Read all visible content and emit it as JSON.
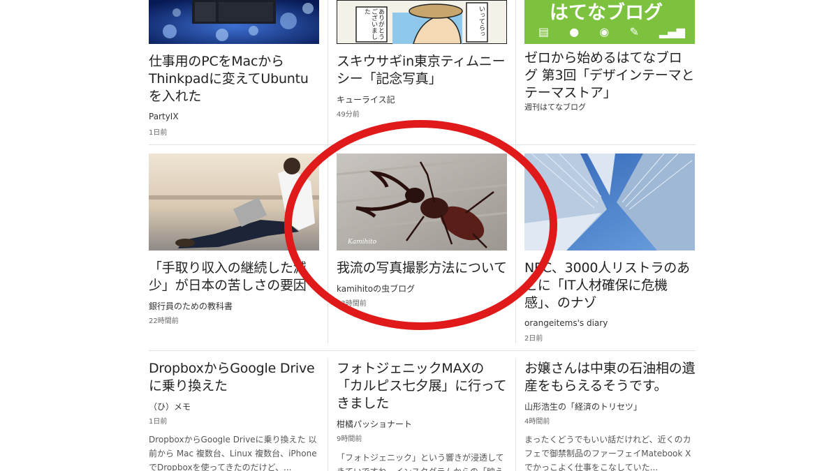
{
  "row1": [
    {
      "title": "仕事用のPCをMacからThinkpadに変えてUbuntuを入れた",
      "source": "PartyIX",
      "time": "1日前"
    },
    {
      "title": "スキウサギin東京ティムニーシー「記念写真」",
      "source": "キューライス記",
      "time": "49分前"
    },
    {
      "title": "ゼロから始めるはてなブログ 第3回「デザインテーマとテーマストア」",
      "source": "週刊はてなブログ",
      "time": "",
      "thumb_text": "はてなブログ"
    }
  ],
  "row2": [
    {
      "title": "「手取り収入の継続した減少」が日本の苦しさの要因",
      "source": "銀行員のための教科書",
      "time": "22時間前"
    },
    {
      "title": "我流の写真撮影方法について",
      "source": "kamihitoの虫ブログ",
      "time": "23時間前",
      "watermark": "Kamihito"
    },
    {
      "title": "NEC、3000人リストラのあとに「IT人材確保に危機感」、のナゾ",
      "source": "orangeitems's diary",
      "time": "2日前"
    }
  ],
  "row3": [
    {
      "title": "DropboxからGoogle Driveに乗り換えた",
      "source": "（ひ）メモ",
      "time": "1日前",
      "excerpt": "DropboxからGoogle Driveに乗り換えた 以前から Mac 複数台、Linux 複数台、iPhoneでDropboxを使ってきたのだけど、..."
    },
    {
      "title": "フォトジェニックMAXの「カルピス七夕展」に行ってきました",
      "source": "柑橘パッショナート",
      "time": "9時間前",
      "excerpt": "「フォトジェニック」という響きが浸透してきていですね。インスタグラムからの「映え"
    },
    {
      "title": "お嬢さんは中東の石油相の遺産をもらえるそうです。",
      "source": "山形浩生の「経済のトリセツ」",
      "time": "4時間前",
      "excerpt": "まったくどうでもいい話だけれど、近くのカフェで御禁制品のファーフェイMatebook Xでかっこよく仕事をこなしていた..."
    }
  ],
  "thumb1_2_text": "ありがとうございました",
  "thumb1_2_text2": "いってらっ",
  "colors": {
    "highlight": "#e01a1a",
    "hatena_green": "#7cc23f"
  }
}
